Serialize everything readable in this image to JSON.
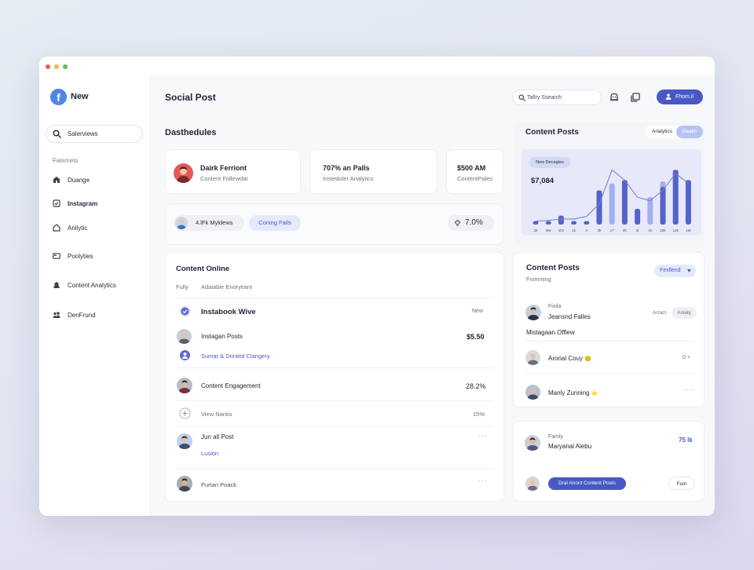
{
  "app": {
    "brand": "New",
    "title": "Social Post"
  },
  "sidebar": {
    "search": "Salerviews",
    "section": "Faismets",
    "items": [
      {
        "label": "Duange",
        "icon": "home-icon"
      },
      {
        "label": "Instagram",
        "icon": "checkbox-icon"
      },
      {
        "label": "Anilytic",
        "icon": "house-outline-icon"
      },
      {
        "label": "Poolyties",
        "icon": "card-icon"
      },
      {
        "label": "Content Analytics",
        "icon": "people-icon"
      },
      {
        "label": "DenFrund",
        "icon": "group-icon"
      }
    ]
  },
  "header": {
    "search_placeholder": "Tallry Ssearch",
    "primary_button": "Fhom.il"
  },
  "dashboard": {
    "title": "Dasthedules",
    "stat_cards": [
      {
        "title": "Dairk Ferriont",
        "subtitle": "Content Follewdar"
      },
      {
        "title": "707% ⁠an Palls",
        "subtitle": "Insteduler Analytics"
      },
      {
        "title": "$500 AM",
        "subtitle": "ContentPales"
      }
    ],
    "chip_user": "4.lFk Myldews",
    "chip_status": "Coning Fails",
    "chip_value": "7.0%"
  },
  "content_online": {
    "title": "Content Online",
    "tabs": [
      "Fully",
      "Adaiable Enorytiant"
    ],
    "rows": [
      {
        "title": "Instabook Wive",
        "value": "New"
      },
      {
        "title": "Instagan Posts",
        "value": "$5.50",
        "sub": "Sumar & Drinted Clangery"
      },
      {
        "title": "Content Engagement",
        "value": "28.2%"
      },
      {
        "title": "View Nanks",
        "value": "15%"
      },
      {
        "title": "Jun all Post",
        "value": "···",
        "sub": "Lusion"
      },
      {
        "title": "Purtan Poack",
        "value": "···"
      }
    ]
  },
  "chart_panel": {
    "title": "Content Posts",
    "toggle": [
      "Analytics",
      "Dealin"
    ],
    "badge": "New Decagtes",
    "total": "$7,084"
  },
  "chart_data": {
    "type": "bar",
    "categories": [
      "2b",
      "Mw",
      "10s",
      "1k",
      "4",
      "3k",
      "1?",
      "2b",
      "2l",
      "1k",
      "15k",
      "14k",
      "1M"
    ],
    "series": [
      {
        "values": [
          0.5,
          0.5,
          1.3,
          0.5,
          0.5,
          5.0,
          6.0,
          6.5,
          2.3,
          4.0,
          5.5,
          8.0,
          6.5
        ]
      },
      {
        "values": [
          0,
          0,
          0,
          0,
          0,
          0,
          0,
          0,
          0,
          0,
          6.3,
          7.0,
          0
        ]
      }
    ],
    "trend": [
      0.5,
      0.6,
      0.8,
      0.8,
      1.2,
      3.0,
      8.0,
      6.5,
      4.0,
      3.5,
      5.0,
      7.5,
      6.0
    ],
    "colors": {
      "dark": "#5562c8",
      "light": "#a3b0ee",
      "line": "#6f7ccc"
    }
  },
  "posts_panel": {
    "title": "Content Posts",
    "subtitle": "Fromming",
    "dropdown": "Fexllend",
    "featured": {
      "role": "Fixila",
      "name": "Jeansnd Falles",
      "action": "Arract",
      "badge": "Anialy"
    },
    "section": "Mistagaan Offlew",
    "rows": [
      {
        "name": "Arorial Couy",
        "emoji": "😊",
        "value": "0 +"
      },
      {
        "name": "Manly Zunning",
        "emoji": "⭐",
        "value": "····"
      }
    ]
  },
  "bottom_panel": {
    "role": "Famly",
    "name": "Maryanal Alebu",
    "value": "75 lk",
    "cta": "Dral Anont Content Posts",
    "secondary": "Fuin"
  }
}
